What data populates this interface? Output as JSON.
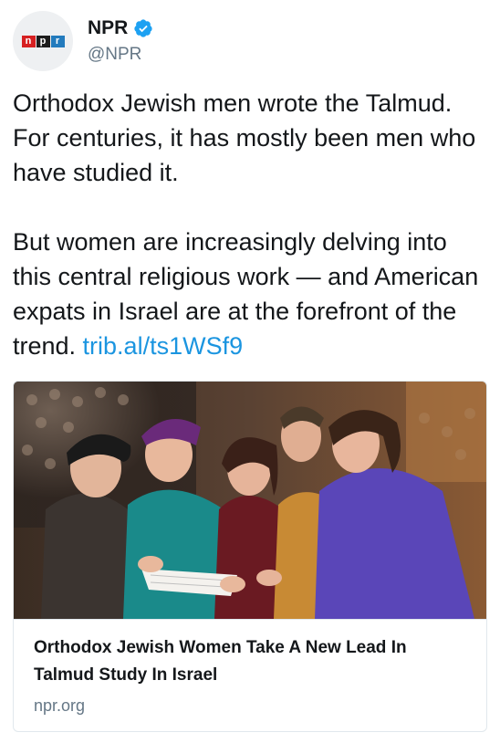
{
  "author": {
    "display_name": "NPR",
    "handle": "@NPR",
    "avatar_letters": [
      "n",
      "p",
      "r"
    ],
    "verified_icon": "verified-badge-icon",
    "brand_colors": [
      "#d62021",
      "#1d1d1d",
      "#237bbd"
    ]
  },
  "tweet": {
    "paragraph1": "Orthodox Jewish men wrote the Talmud. For centuries, it has mostly been men who have studied it.",
    "paragraph2_text": "But women are increasingly delving into this central religious work — and American expats in Israel are at the forefront of the trend. ",
    "link_text": "trib.al/ts1WSf9",
    "link_color": "#1b95e0"
  },
  "card": {
    "title": "Orthodox Jewish Women Take A New Lead In Talmud Study In Israel",
    "domain": "npr.org"
  }
}
